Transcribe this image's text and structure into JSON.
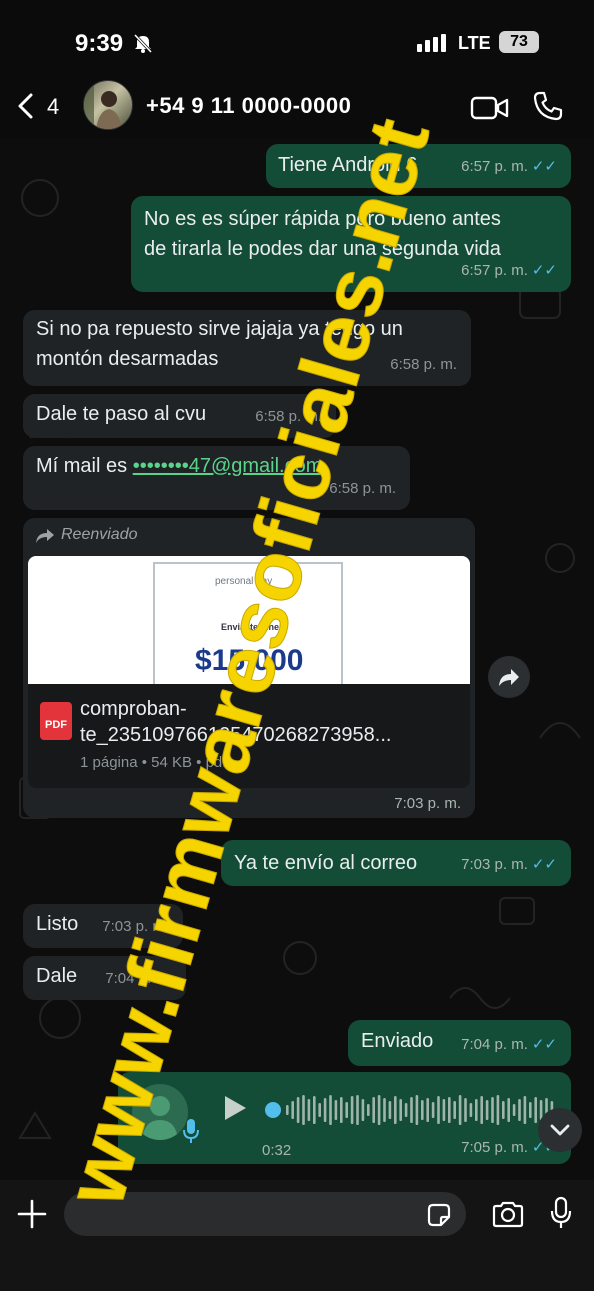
{
  "status_bar": {
    "time": "9:39",
    "network": "LTE",
    "battery": "73"
  },
  "header": {
    "back_count": "4",
    "contact_name": "+54 9 11 0000-0000"
  },
  "messages": [
    {
      "dir": "out",
      "text": "Tiene Android 6",
      "time": "6:57 p. m.",
      "ticks": "✓✓"
    },
    {
      "dir": "out",
      "text": "No es es súper rápida pero bueno antes\nde tirarla le podes dar una segunda vida",
      "time": "6:57 p. m.",
      "ticks": "✓✓"
    },
    {
      "dir": "in",
      "text": "Si no pa repuesto sirve jajaja ya tengo un\nmontón desarmadas",
      "time": "6:58 p. m."
    },
    {
      "dir": "in",
      "text": "Dale te paso al cvu",
      "time": "6:58 p. m."
    },
    {
      "dir": "in",
      "text_prefix": "Mí mail es ",
      "email": "••••••••47@gmail.com",
      "time": "6:58 p. m."
    }
  ],
  "forwarded": {
    "label": "Reenviado",
    "preview_logo": "personal pay",
    "preview_sub": "Enviaste dinero",
    "preview_amount": "$15.000",
    "file_icon": "PDF",
    "file_name": "comproban-\nte_2351097661254702682739​58...",
    "file_info": "1 página • 54 KB • pdf",
    "time": "7:03 p. m."
  },
  "messages2": [
    {
      "dir": "out",
      "text": "Ya te envío al correo",
      "time": "7:03 p. m.",
      "ticks": "✓✓"
    },
    {
      "dir": "in",
      "text": "Listo",
      "time": "7:03 p. m."
    },
    {
      "dir": "in",
      "text": "Dale",
      "time": "7:04 p. m."
    },
    {
      "dir": "out",
      "text": "Enviado",
      "time": "7:04 p. m.",
      "ticks": "✓✓"
    }
  ],
  "voice": {
    "duration": "0:32",
    "time": "7:05 p. m.",
    "ticks": "✓✓"
  },
  "composer": {
    "placeholder": ""
  },
  "watermark": "www.firmwaresoficiales.net",
  "colors": {
    "outgoing": "#134d37",
    "incoming": "#202325",
    "ticks": "#53bdeb",
    "watermark": "#f5d400"
  }
}
